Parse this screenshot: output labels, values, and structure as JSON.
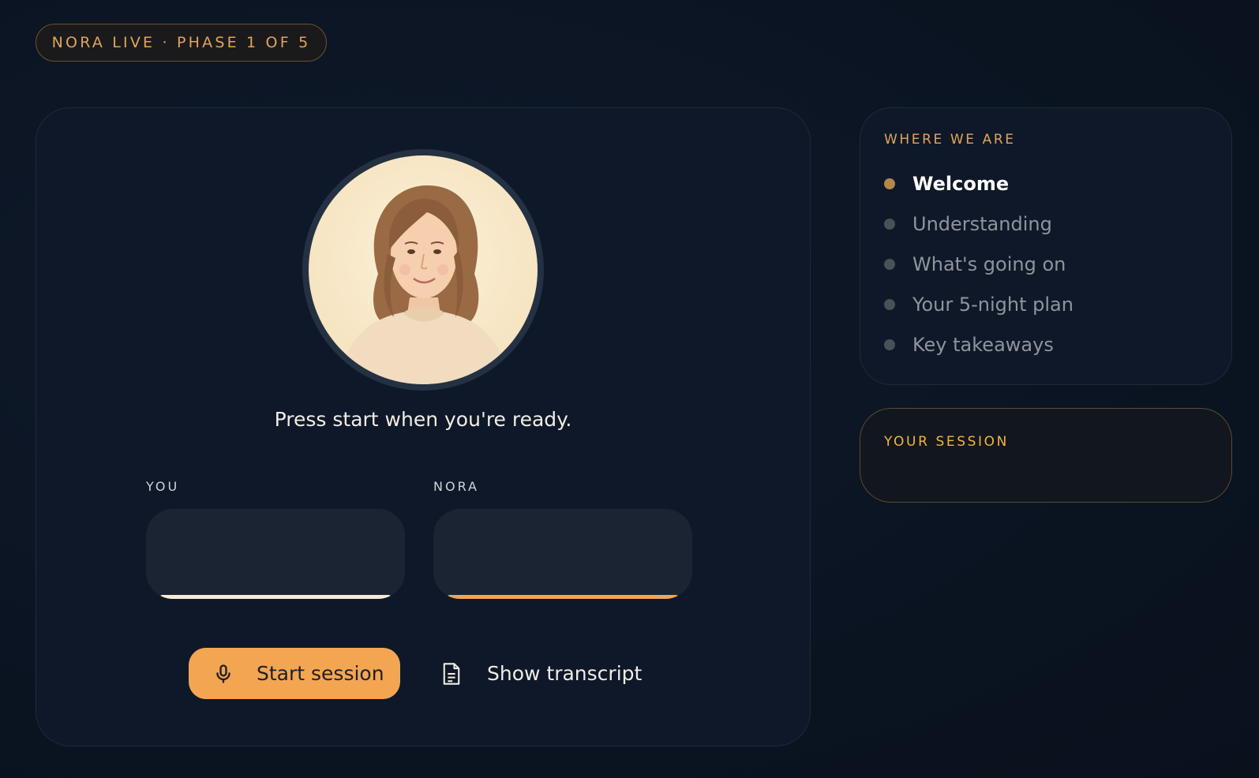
{
  "phase_pill": "NORA LIVE · PHASE 1 OF 5",
  "main": {
    "prompt": "Press start when you're ready.",
    "meters": [
      {
        "label": "YOU",
        "color": "#f4ecd6"
      },
      {
        "label": "NORA",
        "color": "#f4a552"
      }
    ],
    "start_label": "Start session",
    "transcript_label": "Show transcript",
    "icons": {
      "start": "microphone-icon",
      "transcript": "document-icon"
    }
  },
  "phases": {
    "title": "WHERE WE ARE",
    "items": [
      {
        "label": "Welcome",
        "active": true
      },
      {
        "label": "Understanding",
        "active": false
      },
      {
        "label": "What's going on",
        "active": false
      },
      {
        "label": "Your 5-night plan",
        "active": false
      },
      {
        "label": "Key takeaways",
        "active": false
      }
    ]
  },
  "session": {
    "title": "YOUR SESSION"
  },
  "colors": {
    "accent": "#f4a552",
    "accent_text": "#e2a45b",
    "background": "#0b1422"
  }
}
